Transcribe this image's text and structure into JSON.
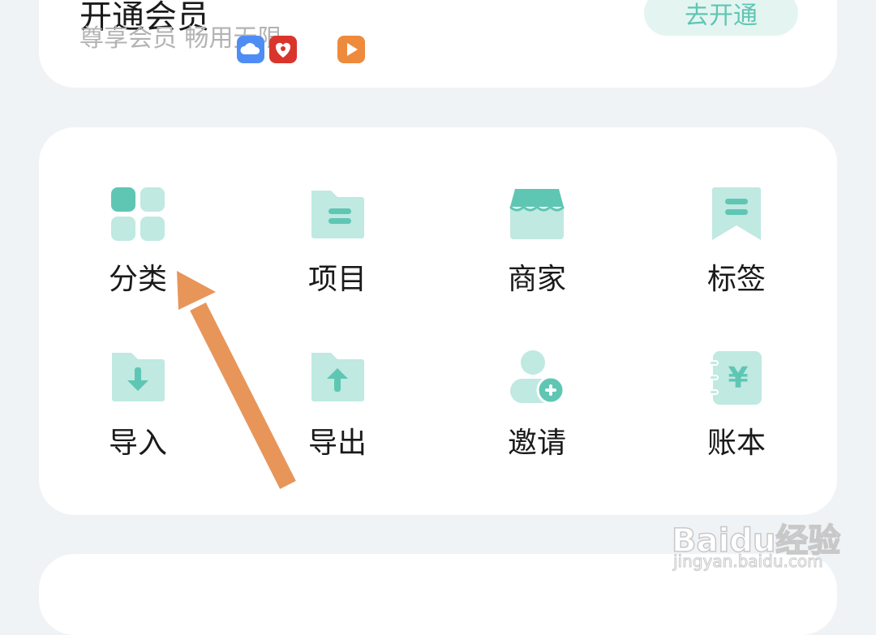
{
  "membership": {
    "title": "开通会员",
    "subtitle": "尊享会员 畅用无限",
    "open_label": "去开通"
  },
  "app_icons": [
    "cloud-app-icon",
    "heart-app-icon",
    "play-app-icon"
  ],
  "menu": {
    "items": [
      {
        "label": "分类",
        "icon": "category-grid-icon"
      },
      {
        "label": "项目",
        "icon": "project-folder-icon"
      },
      {
        "label": "商家",
        "icon": "store-icon"
      },
      {
        "label": "标签",
        "icon": "bookmark-tag-icon"
      },
      {
        "label": "导入",
        "icon": "import-folder-icon"
      },
      {
        "label": "导出",
        "icon": "export-folder-icon"
      },
      {
        "label": "邀请",
        "icon": "invite-user-icon"
      },
      {
        "label": "账本",
        "icon": "ledger-book-icon"
      }
    ]
  },
  "watermark": {
    "brand": "Baidu经验",
    "url": "jingyan.baidu.com"
  },
  "colors": {
    "accent": "#5fc6b4",
    "accent_light": "#bfe9e1",
    "annotation_arrow": "#e8955a"
  }
}
